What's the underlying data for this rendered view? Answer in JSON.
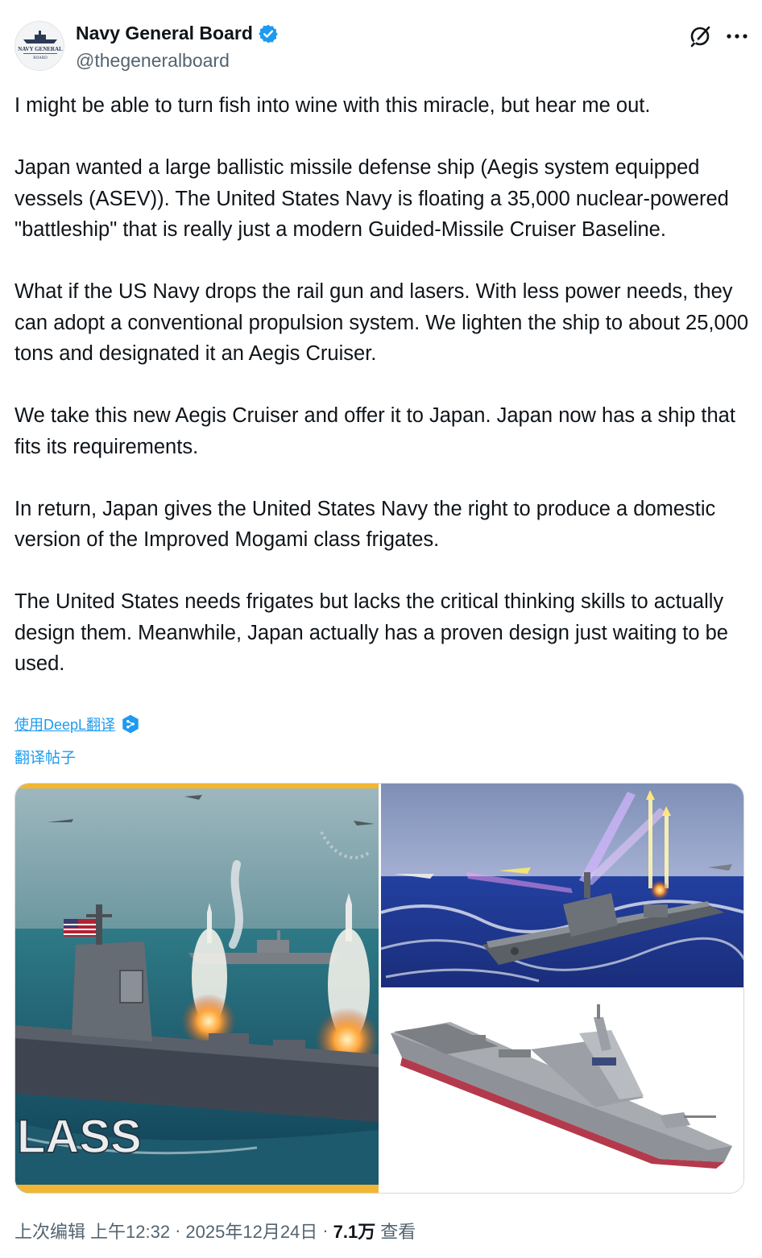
{
  "author": {
    "display_name": "Navy General Board",
    "handle": "@thegeneralboard",
    "verified_icon": "verified-badge-icon",
    "avatar_text_line1": "NAVY GENERAL",
    "avatar_text_line2": "BOARD"
  },
  "header_icons": [
    "grok-icon",
    "more-icon"
  ],
  "paragraphs": [
    "I might be able to turn fish into wine with this miracle, but hear me out.",
    "Japan wanted a large ballistic missile defense ship (Aegis system equipped vessels (ASEV)). The United States Navy is floating a 35,000 nuclear-powered \"battleship\" that is really just a modern Guided-Missile Cruiser Baseline.",
    "What if the US Navy drops the rail gun and lasers. With less power needs, they can adopt a conventional propulsion system. We lighten the ship to about 25,000 tons and designated it an Aegis Cruiser.",
    "We take this new Aegis Cruiser and offer it to Japan. Japan now has a ship that fits its requirements.",
    "In return, Japan gives the United States Navy the right to produce a domestic version of the Improved Mogami class frigates.",
    "The United States needs frigates but lacks the critical thinking skills to actually design them. Meanwhile, Japan actually has a proven design just waiting to be used."
  ],
  "translate": {
    "deepl_label": "使用DeepL翻译",
    "post_label": "翻译帖子"
  },
  "media": {
    "left_overlay_text": "LASS"
  },
  "meta": {
    "edited_label": "上次编辑",
    "time": "上午12:32",
    "sep1": "·",
    "date": "2025年12月24日",
    "sep2": "·",
    "views_count": "7.1万",
    "views_label": "查看"
  },
  "colors": {
    "accent": "#1d9bf0",
    "secondary_text": "#536471",
    "primary_text": "#0f1419"
  }
}
